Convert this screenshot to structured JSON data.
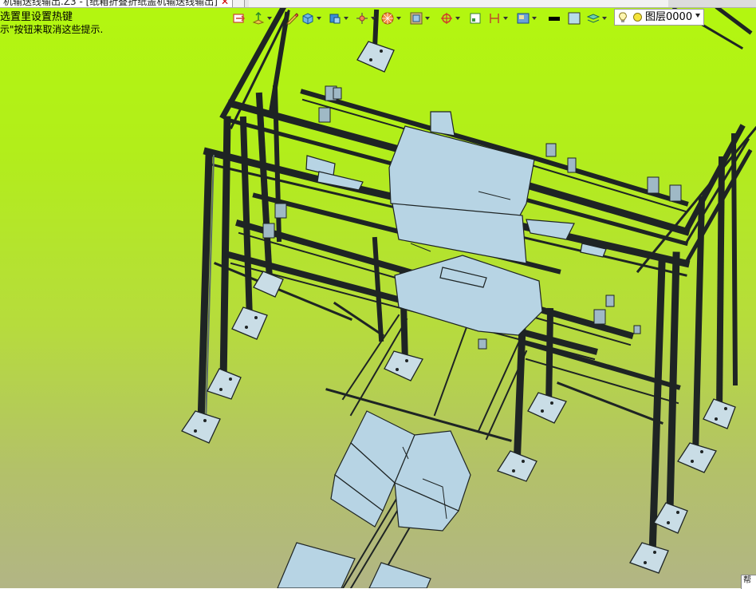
{
  "window": {
    "tab_title": "机输送线输出.Z3 - [纸箱折叠折纸盖机输送线输出]",
    "tab_close": "✕"
  },
  "hints": {
    "line1": "选置里设置热键",
    "line2": "示\"按钮来取消这些提示."
  },
  "toolbar": {
    "items": [
      {
        "icon": "plane-align-icon",
        "dropdown": false
      },
      {
        "icon": "move-tool-icon",
        "dropdown": true
      },
      {
        "icon": "pencil-sketch-icon",
        "dropdown": false
      },
      {
        "icon": "solid-box-icon",
        "dropdown": true
      },
      {
        "icon": "cube-view-icon",
        "dropdown": true
      },
      {
        "icon": "view-orient-icon",
        "dropdown": true
      },
      {
        "icon": "shaded-sphere-icon",
        "dropdown": true
      },
      {
        "icon": "texture-icon",
        "dropdown": true
      },
      {
        "icon": "snap-target-icon",
        "dropdown": true
      },
      {
        "icon": "datum-icon",
        "dropdown": false
      },
      {
        "icon": "dimension-icon",
        "dropdown": true
      },
      {
        "icon": "render-mode-icon",
        "dropdown": true
      },
      {
        "icon": "line-color-icon",
        "dropdown": false
      },
      {
        "icon": "face-color-icon",
        "dropdown": false
      },
      {
        "icon": "layers-icon",
        "dropdown": true
      }
    ],
    "layer": {
      "name": "图层0000"
    }
  },
  "corner_widget": {
    "label": "帮"
  },
  "colors": {
    "viewport_top": "#b3f70f",
    "viewport_bottom": "#b2b585",
    "steel": "#1e2424",
    "plate": "#b7d4e4"
  }
}
